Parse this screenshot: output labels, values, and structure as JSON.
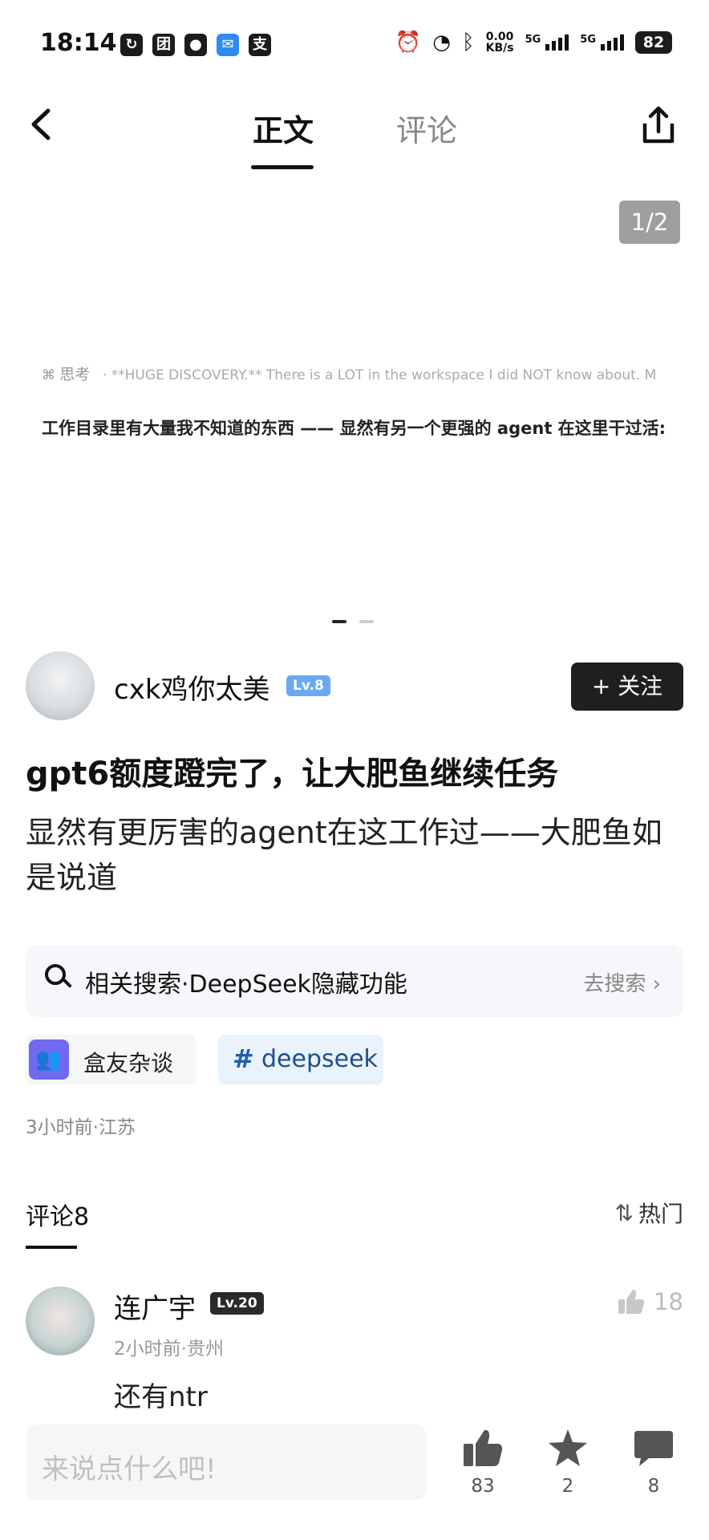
{
  "status_bar": {
    "time": "18:14",
    "left_icons": [
      "sync-icon",
      "app-tuan-icon",
      "wechat-icon",
      "mail-icon",
      "alipay-icon"
    ],
    "net_speed_value": "0.00",
    "net_speed_unit": "KB/s",
    "signal1_label": "5G",
    "signal2_label": "5G",
    "battery": "82"
  },
  "header": {
    "tab_main": "正文",
    "tab_comments": "评论"
  },
  "image_post": {
    "page_counter": "1/2",
    "think_label": "思考",
    "think_text": "· **HUGE DISCOVERY.** There is a LOT in the workspace I did NOT know about. M",
    "translation": "工作目录里有大量我不知道的东西 —— 显然有另一个更强的 agent 在这里干过活:"
  },
  "author": {
    "name": "cxk鸡你太美",
    "level": "Lv.8",
    "follow_label": "+ 关注"
  },
  "post": {
    "title": "gpt6额度蹬完了，让大肥鱼继续任务",
    "body": "显然有更厉害的agent在这工作过——大肥鱼如是说道",
    "related_search": "相关搜索·DeepSeek隐藏功能",
    "go_search": "去搜索",
    "tag_group": "盒友杂谈",
    "tag_topic": "deepseek",
    "meta": "3小时前·江苏"
  },
  "comments": {
    "header": "评论8",
    "sort_label": "热门",
    "items": [
      {
        "name": "连广宇",
        "level": "Lv.20",
        "meta": "2小时前·贵州",
        "text": "还有ntr",
        "likes": "18"
      }
    ]
  },
  "bottom_bar": {
    "input_placeholder": "来说点什么吧!",
    "likes": "83",
    "stars": "2",
    "comments": "8"
  },
  "colors": {
    "follow_button": "#1f1f1f",
    "level_badge": "#6aa9f0",
    "tag_icon": "#6f6af0",
    "topic_tag_text": "#1f4f8a"
  }
}
